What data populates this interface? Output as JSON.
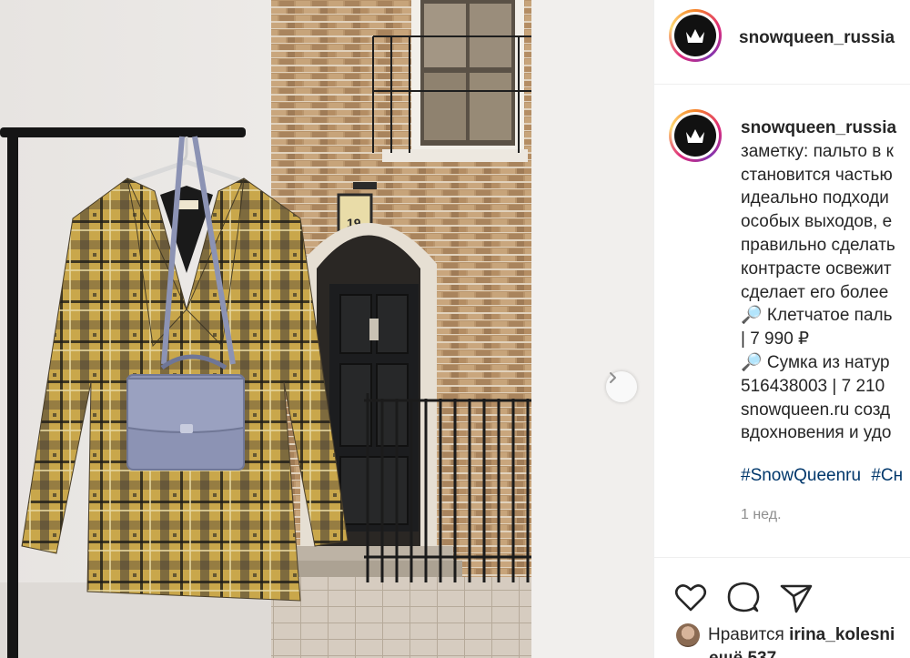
{
  "post": {
    "author": "snowqueen_russia",
    "caption_lines": [
      "заметку: пальто в к",
      "становится частью",
      "идеально подходи",
      "особых выходов, е",
      "правильно сделать",
      "контрасте освежит",
      "сделает его более",
      "🔎 Клетчатое паль",
      "| 7 990 ₽",
      "🔎 Сумка из натур",
      "516438003 | 7 210",
      "snowqueen.ru созд",
      "вдохновения и удо"
    ],
    "hashtags": [
      "#SnowQueenru",
      "#Сн"
    ],
    "time_ago": "1 нед.",
    "likes_prefix": "Нравится ",
    "likes_user": "irina_kolesni",
    "likes_more": "ещё 537"
  },
  "photo": {
    "house_number": "19",
    "colors": {
      "wall": "#ece9e6",
      "brick": "#b9956c",
      "door": "#1c1d1f",
      "coat_base": "#c9a74b",
      "bag": "#8c93b4"
    }
  },
  "icons": [
    "crown-logo-icon",
    "chevron-right-icon",
    "heart-icon",
    "comment-icon",
    "share-icon"
  ],
  "colors": {
    "text": "#262626",
    "muted": "#8e8e8e",
    "hashtag": "#00376b",
    "divider": "#efefef"
  }
}
